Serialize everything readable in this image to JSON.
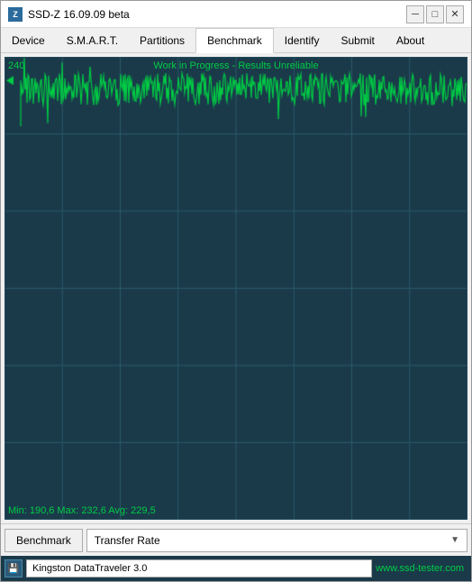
{
  "window": {
    "title": "SSD-Z 16.09.09 beta",
    "icon_label": "Z"
  },
  "title_controls": {
    "minimize": "─",
    "maximize": "□",
    "close": "✕"
  },
  "menu": {
    "items": [
      {
        "id": "device",
        "label": "Device"
      },
      {
        "id": "smart",
        "label": "S.M.A.R.T."
      },
      {
        "id": "partitions",
        "label": "Partitions"
      },
      {
        "id": "benchmark",
        "label": "Benchmark"
      },
      {
        "id": "identify",
        "label": "Identify"
      },
      {
        "id": "submit",
        "label": "Submit"
      },
      {
        "id": "about",
        "label": "About"
      }
    ]
  },
  "chart": {
    "header": "Work in Progress - Results Unreliable",
    "y_max": "240",
    "y_min": "0",
    "stats": "Min: 190,6  Max: 232,6  Avg: 229,5",
    "grid_color": "#2a5a6a",
    "line_color": "#00cc44",
    "bg_color": "#1a3a4a"
  },
  "toolbar": {
    "benchmark_label": "Benchmark",
    "dropdown_value": "Transfer Rate",
    "dropdown_arrow": "▼"
  },
  "statusbar": {
    "device_name": "Kingston DataTraveler 3.0",
    "url": "www.ssd-tester.com"
  }
}
